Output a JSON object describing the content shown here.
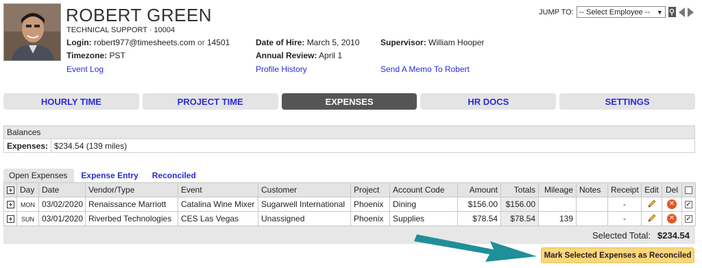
{
  "employee": {
    "name": "ROBERT GREEN",
    "role_line": "TECHNICAL SUPPORT · 10004",
    "login_label": "Login:",
    "login_value": "robert977@timesheets.com",
    "login_or": "or",
    "login_id": "14501",
    "timezone_label": "Timezone:",
    "timezone_value": "PST",
    "event_log_link": "Event Log",
    "hire_label": "Date of Hire:",
    "hire_value": "March 5, 2010",
    "review_label": "Annual Review:",
    "review_value": "April 1",
    "profile_history_link": "Profile History",
    "supervisor_label": "Supervisor:",
    "supervisor_value": "William Hooper",
    "memo_link": "Send A Memo To Robert"
  },
  "jump": {
    "label": "JUMP TO:",
    "selected": "-- Select Employee --"
  },
  "tabs": [
    {
      "label": "HOURLY TIME"
    },
    {
      "label": "PROJECT TIME"
    },
    {
      "label": "EXPENSES"
    },
    {
      "label": "HR DOCS"
    },
    {
      "label": "SETTINGS"
    }
  ],
  "balances": {
    "title": "Balances",
    "label": "Expenses:",
    "value": "$234.54 (139 miles)"
  },
  "subtabs": [
    {
      "label": "Open Expenses"
    },
    {
      "label": "Expense Entry"
    },
    {
      "label": "Reconciled"
    }
  ],
  "table": {
    "headers": [
      "Day",
      "Date",
      "Vendor/Type",
      "Event",
      "Customer",
      "Project",
      "Account Code",
      "Amount",
      "Totals",
      "Mileage",
      "Notes",
      "Receipt",
      "Edit",
      "Del"
    ],
    "rows": [
      {
        "day": "MON",
        "date": "03/02/2020",
        "vendor": "Renaissance Marriott",
        "event": "Catalina Wine Mixer",
        "customer": "Sugarwell International",
        "project": "Phoenix",
        "account": "Dining",
        "amount": "$156.00",
        "totals": "$156.00",
        "mileage": "",
        "notes": "",
        "receipt": "-"
      },
      {
        "day": "SUN",
        "date": "03/01/2020",
        "vendor": "Riverbed Technologies",
        "event": "CES Las Vegas",
        "customer": "Unassigned",
        "project": "Phoenix",
        "account": "Supplies",
        "amount": "$78.54",
        "totals": "$78.54",
        "mileage": "139",
        "notes": "",
        "receipt": "-"
      }
    ],
    "selected_total_label": "Selected Total:",
    "selected_total_value": "$234.54"
  },
  "mark_button": "Mark Selected Expenses as Reconciled",
  "colors": {
    "link": "#2b2bd6",
    "tab_active": "#555555",
    "mark_button": "#fbd67c",
    "annotation_arrow": "#1f8f99"
  }
}
